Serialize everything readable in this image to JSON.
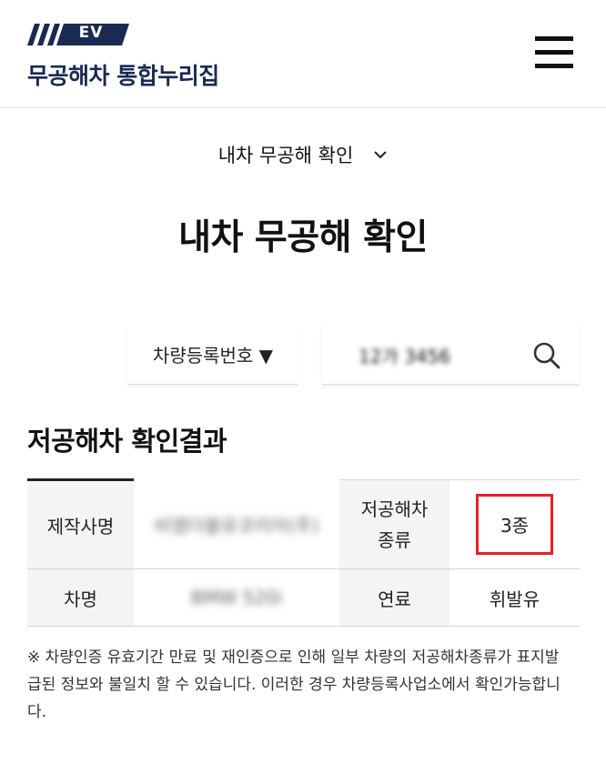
{
  "header": {
    "logo_badge": "EV",
    "site_title": "무공해차 통합누리집",
    "brand_color": "#1b2a52"
  },
  "nav": {
    "dropdown_label": "내차 무공해 확인",
    "icon": "chevron-down-icon"
  },
  "page": {
    "title": "내차 무공해 확인"
  },
  "search": {
    "type_label": "차량등록번호 ▼",
    "input_value": "12가 3456",
    "icon": "search-icon"
  },
  "result": {
    "title": "저공해차 확인결과",
    "rows": [
      {
        "label1": "제작사명",
        "value1": "비엠더블유코리아(주)",
        "label2_line1": "저공해차",
        "label2_line2": "종류",
        "value2": "3종"
      },
      {
        "label1": "차명",
        "value1": "BMW 520i",
        "label2": "연료",
        "value2": "휘발유"
      }
    ],
    "highlight_color": "#e8202a"
  },
  "notice": {
    "text": "※ 차량인증 유효기간 만료 및 재인증으로 인해 일부 차량의 저공해차종류가 표지발급된 정보와 불일치 할 수 있습니다. 이러한 경우 차량등록사업소에서 확인가능합니다."
  }
}
